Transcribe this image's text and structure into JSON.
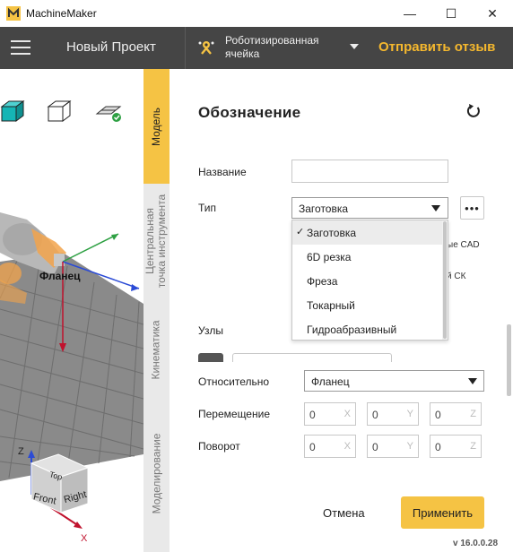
{
  "window": {
    "title": "MachineMaker",
    "controls": {
      "minimize": "—",
      "maximize": "☐",
      "close": "✕"
    }
  },
  "header": {
    "project_title": "Новый Проект",
    "cell_label": "Роботизированная ячейка",
    "feedback": "Отправить отзыв"
  },
  "viewport": {
    "toolbar_icons": [
      "box-front-icon",
      "box-wireframe-icon",
      "plane-check-icon"
    ],
    "flange_label": "Фланец",
    "cube": {
      "top": "Top",
      "front": "Front",
      "right": "Right"
    },
    "axes": {
      "x": "X",
      "z": "Z"
    }
  },
  "tabs": [
    {
      "label": "Модель",
      "active": true
    },
    {
      "label": "Центральная\nточка инструмента",
      "active": false
    },
    {
      "label": "Кинематика",
      "active": false
    },
    {
      "label": "Моделирование",
      "active": false
    }
  ],
  "panel": {
    "title": "Обозначение",
    "name_label": "Название",
    "name_value": "",
    "type_label": "Тип",
    "type_value": "Заготовка",
    "more_label": "•••",
    "behind_text_1": "ые CAD",
    "behind_text_2": "й СК",
    "nodes_label": "Узлы",
    "relative_label": "Относительно",
    "relative_value": "Фланец",
    "move_label": "Перемещение",
    "rotate_label": "Поворот",
    "move": [
      {
        "value": "0",
        "axis": "X"
      },
      {
        "value": "0",
        "axis": "Y"
      },
      {
        "value": "0",
        "axis": "Z"
      }
    ],
    "rotate": [
      {
        "value": "0",
        "axis": "X"
      },
      {
        "value": "0",
        "axis": "Y"
      },
      {
        "value": "0",
        "axis": "Z"
      }
    ],
    "cancel": "Отмена",
    "apply": "Применить",
    "version": "v 16.0.0.28"
  },
  "type_dropdown": {
    "options": [
      "Заготовка",
      "6D резка",
      "Фреза",
      "Токарный",
      "Гидроабразивный"
    ],
    "selected": "Заготовка",
    "check": "✓"
  },
  "colors": {
    "accent": "#f5c344",
    "header_bg": "#454545",
    "feedback": "#f5b82e"
  }
}
